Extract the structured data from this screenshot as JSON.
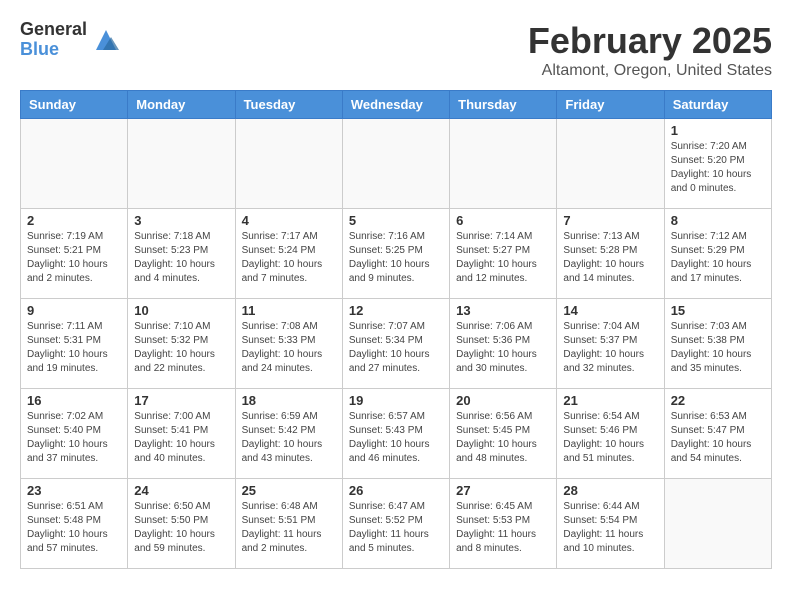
{
  "header": {
    "logo_general": "General",
    "logo_blue": "Blue",
    "month_title": "February 2025",
    "location": "Altamont, Oregon, United States"
  },
  "weekdays": [
    "Sunday",
    "Monday",
    "Tuesday",
    "Wednesday",
    "Thursday",
    "Friday",
    "Saturday"
  ],
  "weeks": [
    [
      {
        "day": "",
        "info": ""
      },
      {
        "day": "",
        "info": ""
      },
      {
        "day": "",
        "info": ""
      },
      {
        "day": "",
        "info": ""
      },
      {
        "day": "",
        "info": ""
      },
      {
        "day": "",
        "info": ""
      },
      {
        "day": "1",
        "info": "Sunrise: 7:20 AM\nSunset: 5:20 PM\nDaylight: 10 hours\nand 0 minutes."
      }
    ],
    [
      {
        "day": "2",
        "info": "Sunrise: 7:19 AM\nSunset: 5:21 PM\nDaylight: 10 hours\nand 2 minutes."
      },
      {
        "day": "3",
        "info": "Sunrise: 7:18 AM\nSunset: 5:23 PM\nDaylight: 10 hours\nand 4 minutes."
      },
      {
        "day": "4",
        "info": "Sunrise: 7:17 AM\nSunset: 5:24 PM\nDaylight: 10 hours\nand 7 minutes."
      },
      {
        "day": "5",
        "info": "Sunrise: 7:16 AM\nSunset: 5:25 PM\nDaylight: 10 hours\nand 9 minutes."
      },
      {
        "day": "6",
        "info": "Sunrise: 7:14 AM\nSunset: 5:27 PM\nDaylight: 10 hours\nand 12 minutes."
      },
      {
        "day": "7",
        "info": "Sunrise: 7:13 AM\nSunset: 5:28 PM\nDaylight: 10 hours\nand 14 minutes."
      },
      {
        "day": "8",
        "info": "Sunrise: 7:12 AM\nSunset: 5:29 PM\nDaylight: 10 hours\nand 17 minutes."
      }
    ],
    [
      {
        "day": "9",
        "info": "Sunrise: 7:11 AM\nSunset: 5:31 PM\nDaylight: 10 hours\nand 19 minutes."
      },
      {
        "day": "10",
        "info": "Sunrise: 7:10 AM\nSunset: 5:32 PM\nDaylight: 10 hours\nand 22 minutes."
      },
      {
        "day": "11",
        "info": "Sunrise: 7:08 AM\nSunset: 5:33 PM\nDaylight: 10 hours\nand 24 minutes."
      },
      {
        "day": "12",
        "info": "Sunrise: 7:07 AM\nSunset: 5:34 PM\nDaylight: 10 hours\nand 27 minutes."
      },
      {
        "day": "13",
        "info": "Sunrise: 7:06 AM\nSunset: 5:36 PM\nDaylight: 10 hours\nand 30 minutes."
      },
      {
        "day": "14",
        "info": "Sunrise: 7:04 AM\nSunset: 5:37 PM\nDaylight: 10 hours\nand 32 minutes."
      },
      {
        "day": "15",
        "info": "Sunrise: 7:03 AM\nSunset: 5:38 PM\nDaylight: 10 hours\nand 35 minutes."
      }
    ],
    [
      {
        "day": "16",
        "info": "Sunrise: 7:02 AM\nSunset: 5:40 PM\nDaylight: 10 hours\nand 37 minutes."
      },
      {
        "day": "17",
        "info": "Sunrise: 7:00 AM\nSunset: 5:41 PM\nDaylight: 10 hours\nand 40 minutes."
      },
      {
        "day": "18",
        "info": "Sunrise: 6:59 AM\nSunset: 5:42 PM\nDaylight: 10 hours\nand 43 minutes."
      },
      {
        "day": "19",
        "info": "Sunrise: 6:57 AM\nSunset: 5:43 PM\nDaylight: 10 hours\nand 46 minutes."
      },
      {
        "day": "20",
        "info": "Sunrise: 6:56 AM\nSunset: 5:45 PM\nDaylight: 10 hours\nand 48 minutes."
      },
      {
        "day": "21",
        "info": "Sunrise: 6:54 AM\nSunset: 5:46 PM\nDaylight: 10 hours\nand 51 minutes."
      },
      {
        "day": "22",
        "info": "Sunrise: 6:53 AM\nSunset: 5:47 PM\nDaylight: 10 hours\nand 54 minutes."
      }
    ],
    [
      {
        "day": "23",
        "info": "Sunrise: 6:51 AM\nSunset: 5:48 PM\nDaylight: 10 hours\nand 57 minutes."
      },
      {
        "day": "24",
        "info": "Sunrise: 6:50 AM\nSunset: 5:50 PM\nDaylight: 10 hours\nand 59 minutes."
      },
      {
        "day": "25",
        "info": "Sunrise: 6:48 AM\nSunset: 5:51 PM\nDaylight: 11 hours\nand 2 minutes."
      },
      {
        "day": "26",
        "info": "Sunrise: 6:47 AM\nSunset: 5:52 PM\nDaylight: 11 hours\nand 5 minutes."
      },
      {
        "day": "27",
        "info": "Sunrise: 6:45 AM\nSunset: 5:53 PM\nDaylight: 11 hours\nand 8 minutes."
      },
      {
        "day": "28",
        "info": "Sunrise: 6:44 AM\nSunset: 5:54 PM\nDaylight: 11 hours\nand 10 minutes."
      },
      {
        "day": "",
        "info": ""
      }
    ]
  ]
}
